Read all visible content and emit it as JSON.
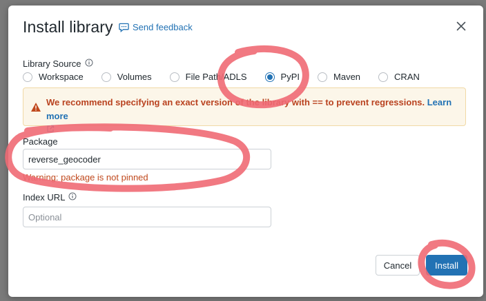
{
  "dialog": {
    "title": "Install library",
    "feedback_label": "Send feedback"
  },
  "library_source": {
    "label": "Library Source",
    "options": [
      {
        "label": "Workspace",
        "checked": false
      },
      {
        "label": "Volumes",
        "checked": false
      },
      {
        "label": "File Path/ADLS",
        "checked": false
      },
      {
        "label": "PyPI",
        "checked": true
      },
      {
        "label": "Maven",
        "checked": false
      },
      {
        "label": "CRAN",
        "checked": false
      }
    ]
  },
  "alert": {
    "message": "We recommend specifying an exact version of the library with == to prevent regressions.",
    "link_label": "Learn more"
  },
  "package": {
    "label": "Package",
    "value": "reverse_geocoder",
    "warning": "Warning: package is not pinned"
  },
  "index_url": {
    "label": "Index URL",
    "placeholder": "Optional"
  },
  "footer": {
    "cancel_label": "Cancel",
    "install_label": "Install"
  },
  "colors": {
    "primary": "#2272b4",
    "warning_text": "#b9421f",
    "alert_bg": "#fcf6e9",
    "annotation": "#f06a74"
  },
  "icons": [
    "feedback-icon",
    "close-icon",
    "info-icon",
    "warning-icon",
    "external-link-icon"
  ]
}
